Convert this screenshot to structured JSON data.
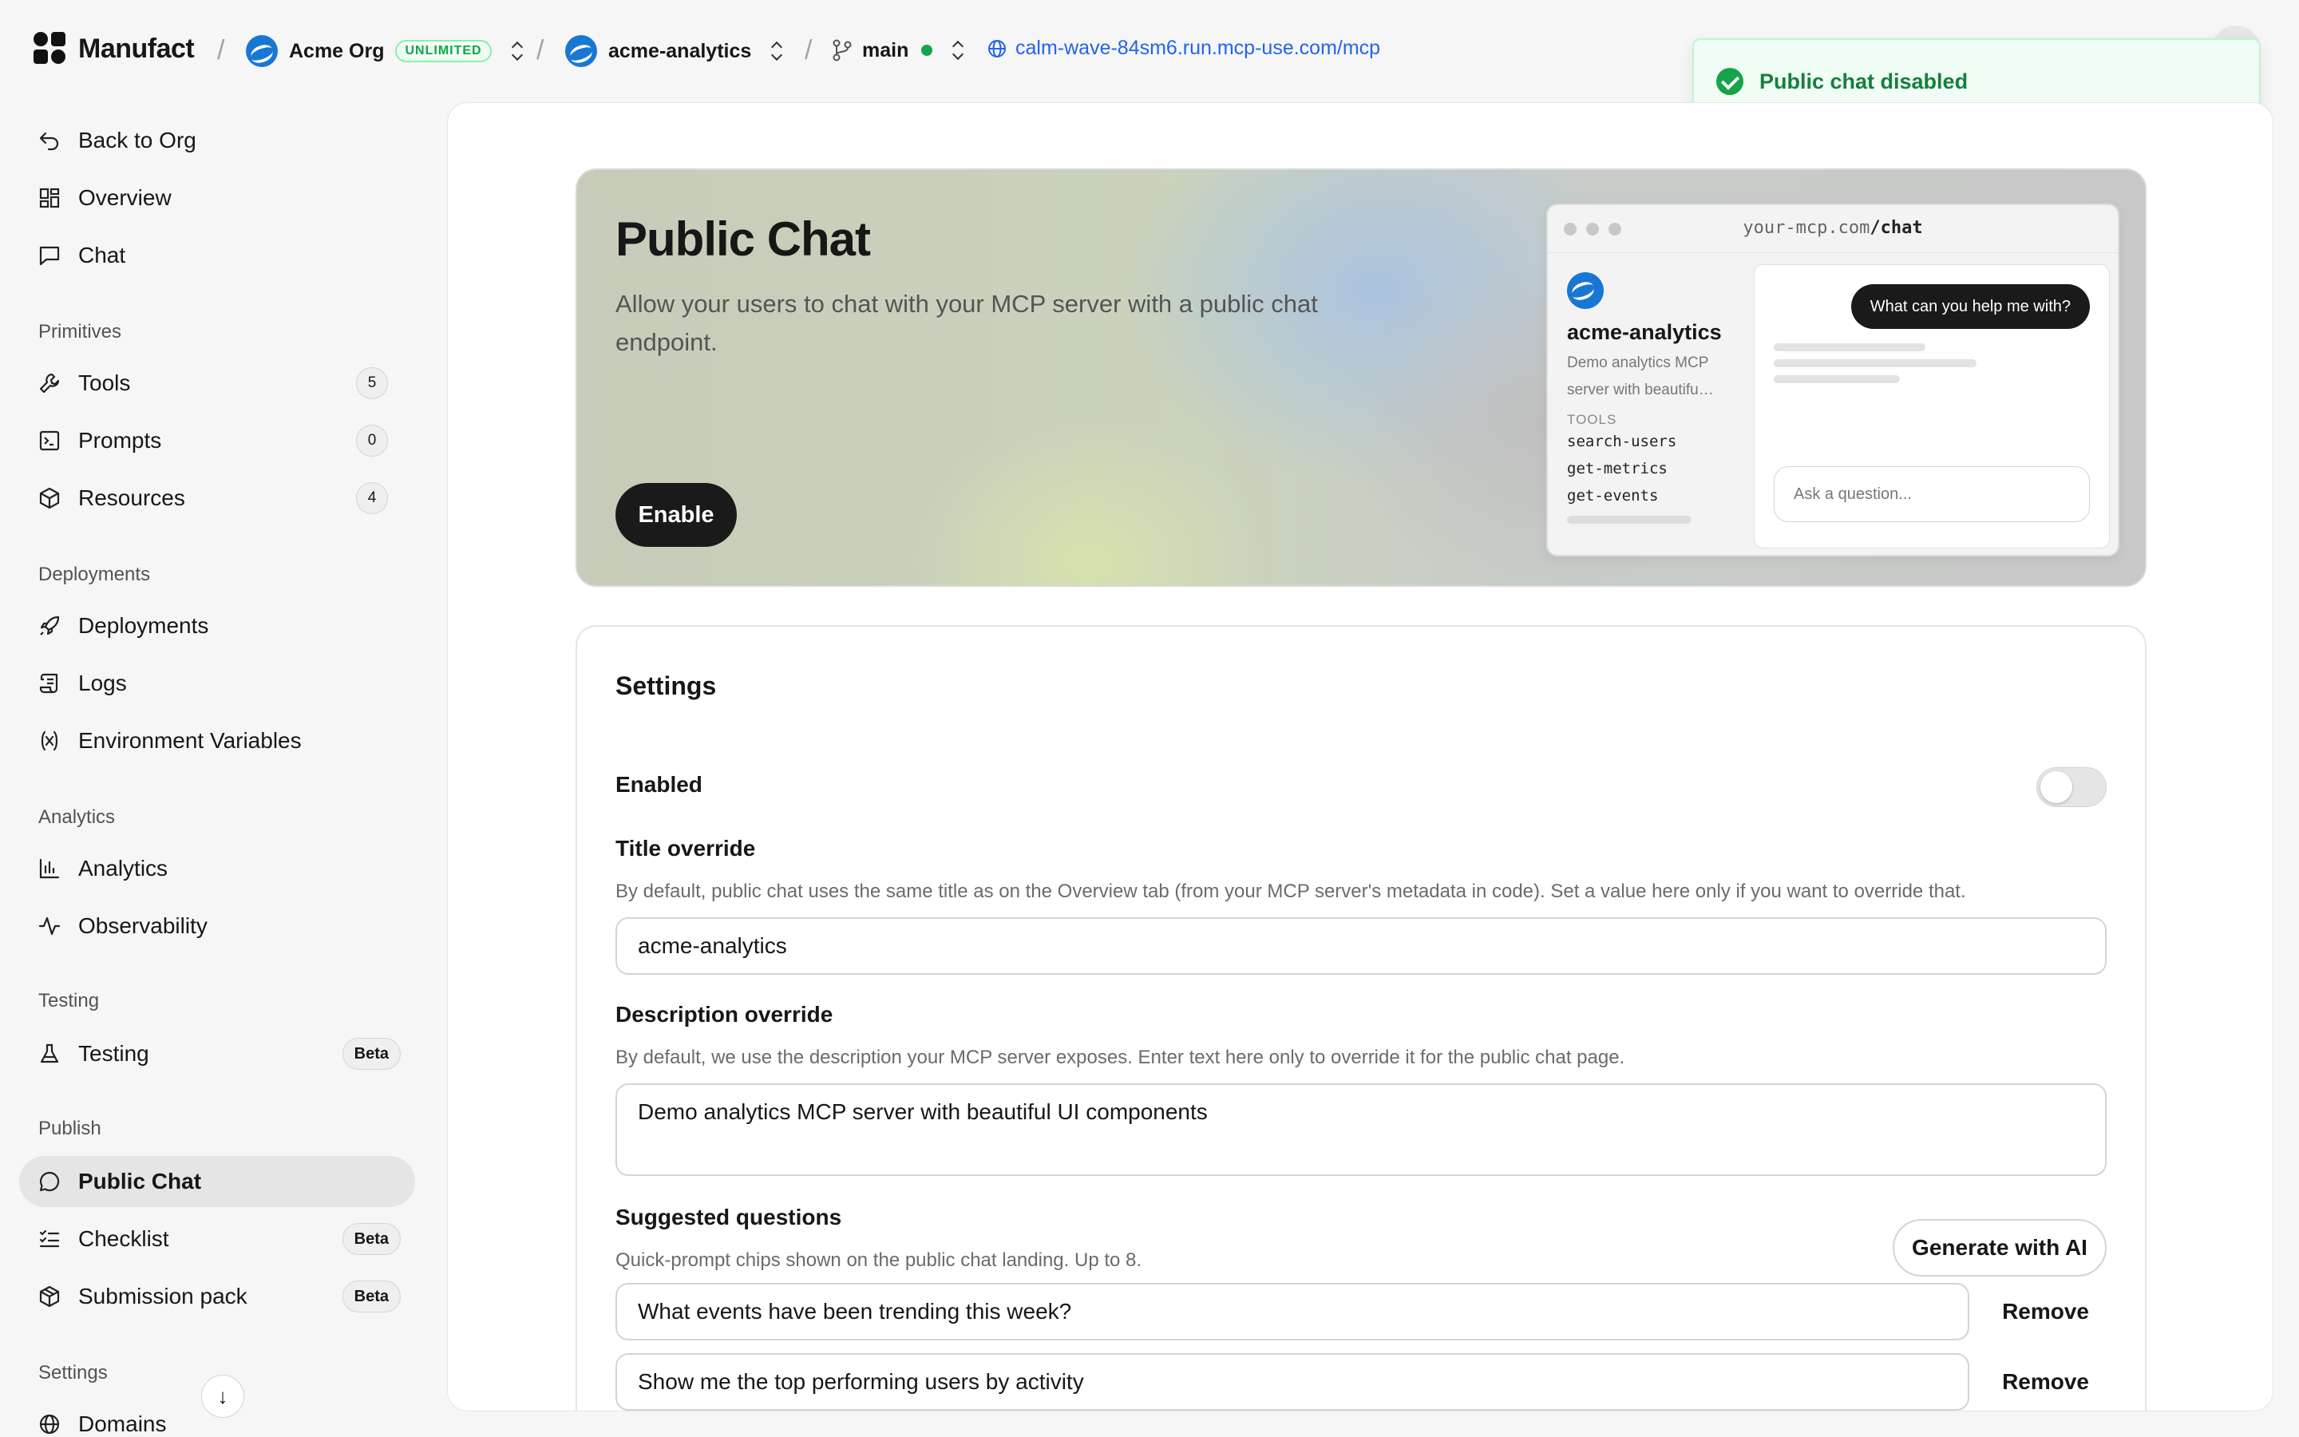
{
  "topbar": {
    "brand": "Manufact",
    "org": "Acme Org",
    "plan_badge": "UNLIMITED",
    "project": "acme-analytics",
    "branch": "main",
    "url": "calm-wave-84sm6.run.mcp-use.com/mcp",
    "separator": "/"
  },
  "toast": {
    "message": "Public chat disabled"
  },
  "sidebar": {
    "top": [
      {
        "label": "Back to Org",
        "icon": "back-arrow-icon"
      },
      {
        "label": "Overview",
        "icon": "grid-icon"
      },
      {
        "label": "Chat",
        "icon": "chat-square-icon"
      }
    ],
    "sections": {
      "primitives": "Primitives",
      "deployments": "Deployments",
      "analytics": "Analytics",
      "testing": "Testing",
      "publish": "Publish",
      "settings": "Settings"
    },
    "items": {
      "tools": {
        "label": "Tools",
        "count": "5"
      },
      "prompts": {
        "label": "Prompts",
        "count": "0"
      },
      "resources": {
        "label": "Resources",
        "count": "4"
      },
      "deployments": {
        "label": "Deployments"
      },
      "logs": {
        "label": "Logs"
      },
      "env": {
        "label": "Environment Variables"
      },
      "analytics": {
        "label": "Analytics"
      },
      "observability": {
        "label": "Observability"
      },
      "testing": {
        "label": "Testing",
        "badge": "Beta"
      },
      "public_chat": {
        "label": "Public Chat"
      },
      "checklist": {
        "label": "Checklist",
        "badge": "Beta"
      },
      "submission": {
        "label": "Submission pack",
        "badge": "Beta"
      },
      "domains": {
        "label": "Domains"
      }
    }
  },
  "hero": {
    "title": "Public Chat",
    "subtitle": "Allow your users to chat with your MCP server with a public chat endpoint.",
    "enable_label": "Enable",
    "preview": {
      "url_host": "your-mcp.com",
      "url_path": "/chat",
      "name": "acme-analytics",
      "desc": "Demo analytics MCP server with beautifu…",
      "tools_heading": "TOOLS",
      "tools": [
        "search-users",
        "get-metrics",
        "get-events"
      ],
      "bubble": "What can you help me with?",
      "ask_placeholder": "Ask a question..."
    }
  },
  "settings": {
    "title": "Settings",
    "enabled_label": "Enabled",
    "enabled": false,
    "title_override": {
      "label": "Title override",
      "help": "By default, public chat uses the same title as on the Overview tab (from your MCP server's metadata in code). Set a value here only if you want to override that.",
      "value": "acme-analytics"
    },
    "description_override": {
      "label": "Description override",
      "help": "By default, we use the description your MCP server exposes. Enter text here only to override it for the public chat page.",
      "value": "Demo analytics MCP server with beautiful UI components"
    },
    "suggested": {
      "label": "Suggested questions",
      "help": "Quick-prompt chips shown on the public chat landing. Up to 8.",
      "generate_label": "Generate with AI",
      "remove_label": "Remove",
      "questions": [
        "What events have been trending this week?",
        "Show me the top performing users by activity"
      ]
    }
  }
}
